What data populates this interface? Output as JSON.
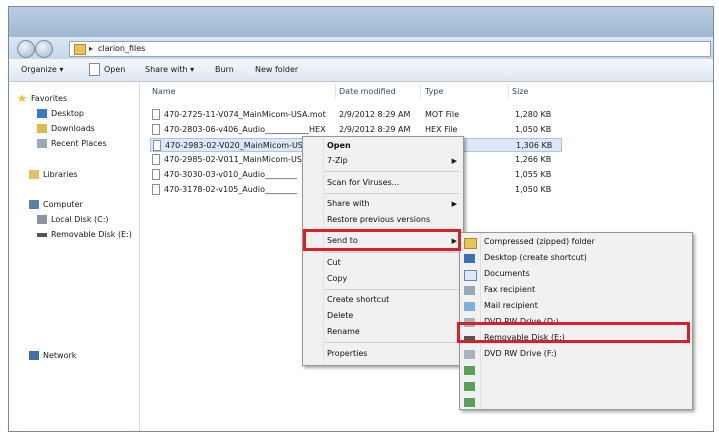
{
  "address": {
    "path": "clarion_files"
  },
  "toolbar": {
    "organize": "Organize ▾",
    "open": "Open",
    "share": "Share with ▾",
    "burn": "Burn",
    "new_folder": "New folder"
  },
  "nav": {
    "favorites": "Favorites",
    "desktop": "Desktop",
    "downloads": "Downloads",
    "recent": "Recent Places",
    "libraries": "Libraries",
    "computer": "Computer",
    "local_disk": "Local Disk (C:)",
    "removable": "Removable Disk (E:)",
    "network": "Network"
  },
  "columns": {
    "name": "Name",
    "date": "Date modified",
    "type": "Type",
    "size": "Size"
  },
  "files": [
    {
      "name": "470-2725-11-V074_MainMicom-USA.mot",
      "date": "2/9/2012 8:29 AM",
      "type": "MOT File",
      "size": "1,280 KB"
    },
    {
      "name": "470-2803-06-v406_Audio___________HEX",
      "date": "2/9/2012 8:29 AM",
      "type": "HEX File",
      "size": "1,050 KB"
    },
    {
      "name": "470-2983-02-V020_MainMicom-USA",
      "date": "",
      "type": "",
      "size": "1,306 KB"
    },
    {
      "name": "470-2985-02-V011_MainMicom-USA",
      "date": "",
      "type": "",
      "size": "1,266 KB"
    },
    {
      "name": "470-3030-03-v010_Audio________",
      "date": "",
      "type": "",
      "size": "1,055 KB"
    },
    {
      "name": "470-3178-02-v105_Audio________",
      "date": "",
      "type": "",
      "size": "1,050 KB"
    }
  ],
  "context_menu": {
    "open": "Open",
    "zip": "7-Zip",
    "scan": "Scan for Viruses...",
    "share": "Share with",
    "restore": "Restore previous versions",
    "send_to": "Send to",
    "cut": "Cut",
    "copy": "Copy",
    "create_shortcut": "Create shortcut",
    "delete": "Delete",
    "rename": "Rename",
    "properties": "Properties"
  },
  "send_to_menu": {
    "compressed": "Compressed (zipped) folder",
    "desktop": "Desktop (create shortcut)",
    "documents": "Documents",
    "fax": "Fax recipient",
    "mail": "Mail recipient",
    "dvd_d": "DVD RW Drive (D:)",
    "removable": "Removable Disk (E:)",
    "dvd_f": "DVD RW Drive (F:)"
  },
  "colors": {
    "highlight": "#d8202a",
    "selection": "#dce8f7"
  }
}
